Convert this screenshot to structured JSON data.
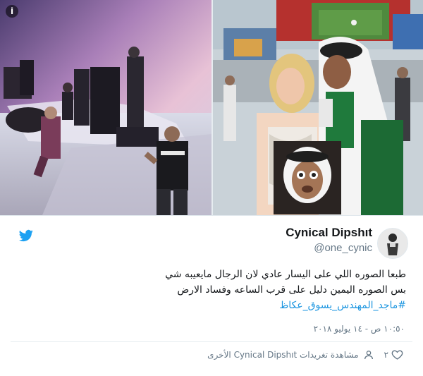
{
  "media": {
    "info_icon": "info-icon"
  },
  "tweet": {
    "display_name": "Cynical Dipshıt",
    "handle": "@one_cynic",
    "text_line_1": "طبعا الصوره اللي على اليسار عادي لان الرجال مايعيبه شي",
    "text_line_2": "بس الصوره اليمين دليل على قرب الساعه وفساد الارض",
    "hashtag": "#ماجد_المهندس_يسوق_عكاظ",
    "timestamp": "١٠:٥٠ ص - ١٤ يوليو ٢٠١٨",
    "like_count": "٢",
    "other_tweets_text": "مشاهدة تغريدات Cynical Dipshıt الأخرى"
  },
  "colors": {
    "twitter_blue": "#1da1f2",
    "link_blue": "#1b95e0",
    "secondary_text": "#657786"
  },
  "icons": [
    "twitter-bird-icon",
    "heart-icon",
    "people-icon",
    "info-icon"
  ]
}
